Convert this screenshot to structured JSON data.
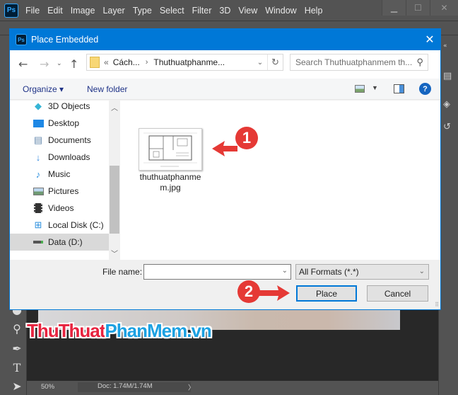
{
  "app": {
    "logo": "Ps",
    "menu": [
      "File",
      "Edit",
      "Image",
      "Layer",
      "Type",
      "Select",
      "Filter",
      "3D",
      "View",
      "Window",
      "Help"
    ],
    "window_controls": {
      "minimize": "minimize-icon",
      "maximize": "maximize-icon",
      "close": "close-icon"
    }
  },
  "dialog": {
    "title": "Place Embedded",
    "logo": "Ps",
    "address": {
      "prefix": "«",
      "segments": [
        "Cách...",
        "Thuthuatphanme..."
      ]
    },
    "search_placeholder": "Search Thuthuatphanmem th...",
    "toolbar": {
      "organize": "Organize ▾",
      "new_folder": "New folder"
    },
    "nav_items": [
      {
        "label": "3D Objects",
        "icon": "3d-objects-icon"
      },
      {
        "label": "Desktop",
        "icon": "desktop-icon"
      },
      {
        "label": "Documents",
        "icon": "documents-icon"
      },
      {
        "label": "Downloads",
        "icon": "downloads-icon"
      },
      {
        "label": "Music",
        "icon": "music-icon"
      },
      {
        "label": "Pictures",
        "icon": "pictures-icon"
      },
      {
        "label": "Videos",
        "icon": "videos-icon"
      },
      {
        "label": "Local Disk (C:)",
        "icon": "local-disk-icon"
      },
      {
        "label": "Data (D:)",
        "icon": "drive-icon",
        "selected": true
      }
    ],
    "files": [
      {
        "name_line1": "thuthuatphanme",
        "name_line2": "m.jpg"
      }
    ],
    "file_name_label": "File name:",
    "file_name_value": "",
    "format": "All Formats (*.*)",
    "place_button": "Place",
    "cancel_button": "Cancel",
    "callouts": [
      "1",
      "2"
    ]
  },
  "status": {
    "zoom": "50%",
    "doc": "Doc: 1.74M/1.74M",
    "arrow": "〉"
  },
  "watermark": {
    "part1": "ThuThuat",
    "part2": "PhanMem.vn"
  },
  "colors": {
    "accent": "#0078d7",
    "callout": "#e53935",
    "ps_bg": "#535353"
  }
}
